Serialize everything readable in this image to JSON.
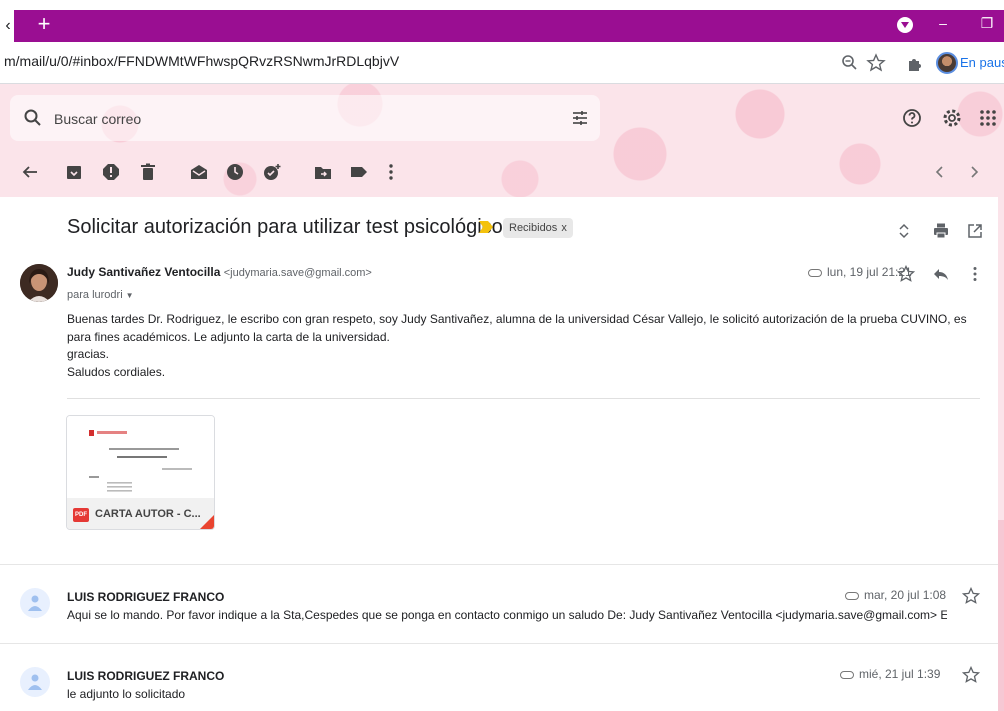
{
  "browser": {
    "url": "m/mail/u/0/#inbox/FFNDWMtWFhwspQRvzRSNwmJrRDLqbjvV",
    "profile_status": "En pausa",
    "new_tab_symbol": "+"
  },
  "gmail": {
    "search_placeholder": "Buscar correo"
  },
  "thread": {
    "subject": "Solicitar autorización para utilizar test psicológico",
    "label": "Recibidos",
    "label_remove": "x"
  },
  "message": {
    "sender_name": "Judy Santivañez Ventocilla",
    "sender_email": "<judymaria.save@gmail.com>",
    "to": "para lurodri",
    "date": "lun, 19 jul 21:21",
    "body": [
      "Buenas tardes Dr. Rodriguez, le escribo con gran respeto, soy Judy Santivañez, alumna de la universidad César Vallejo, le solicitó autorización de la prueba CUVINO, es para fines académicos. Le adjunto la carta de la universidad.",
      "gracias.",
      "Saludos cordiales."
    ],
    "attachment": {
      "type": "PDF",
      "name": "CARTA AUTOR - C..."
    }
  },
  "collapsed_messages": [
    {
      "from": "LUIS RODRIGUEZ FRANCO",
      "date": "mar, 20 jul 1:08",
      "snippet": "Aqui se lo mando. Por favor indique a la Sta,Cespedes que se ponga en contacto conmigo un saludo De: Judy Santivañez Ventocilla <judymaria.save@gmail.com> Envia"
    },
    {
      "from": "LUIS RODRIGUEZ FRANCO",
      "date": "mié, 21 jul 1:39",
      "snippet": "le adjunto lo solicitado"
    }
  ],
  "colors": {
    "browser_frame": "#9a0e92",
    "theme_pink": "#fbe4ea",
    "accent_blue": "#1a73e8"
  },
  "icons": [
    "back-arrow-icon",
    "archive-icon",
    "spam-icon",
    "delete-icon",
    "mark-unread-icon",
    "snooze-icon",
    "add-task-icon",
    "move-to-icon",
    "label-icon",
    "more-icon",
    "help-icon",
    "settings-icon",
    "apps-icon",
    "search-icon",
    "tune-icon",
    "zoom-icon",
    "star-icon",
    "extensions-icon",
    "expand-icon",
    "print-icon",
    "open-new-window-icon",
    "reply-icon",
    "attachment-icon"
  ]
}
